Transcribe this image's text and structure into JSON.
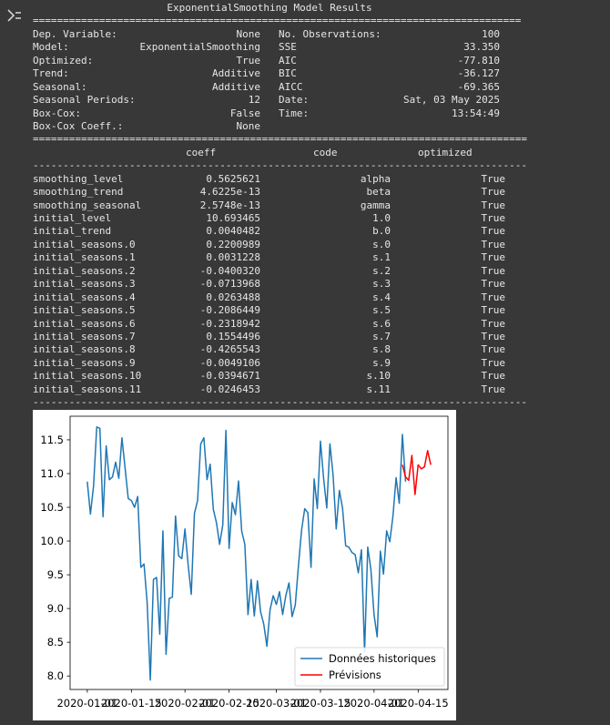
{
  "summary": {
    "title": "ExponentialSmoothing Model Results",
    "separator_eq": "=================================================================================",
    "separator_eq2": "==================================================================================",
    "separator_dash": "----------------------------------------------------------------------------------",
    "info_rows": [
      {
        "k1": "Dep. Variable:",
        "v1": "None",
        "k2": "No. Observations:",
        "v2": "100"
      },
      {
        "k1": "Model:",
        "v1": "ExponentialSmoothing",
        "k2": "SSE",
        "v2": "33.350"
      },
      {
        "k1": "Optimized:",
        "v1": "True",
        "k2": "AIC",
        "v2": "-77.810"
      },
      {
        "k1": "Trend:",
        "v1": "Additive",
        "k2": "BIC",
        "v2": "-36.127"
      },
      {
        "k1": "Seasonal:",
        "v1": "Additive",
        "k2": "AICC",
        "v2": "-69.365"
      },
      {
        "k1": "Seasonal Periods:",
        "v1": "12",
        "k2": "Date:",
        "v2": "Sat, 03 May 2025"
      },
      {
        "k1": "Box-Cox:",
        "v1": "False",
        "k2": "Time:",
        "v2": "13:54:49"
      },
      {
        "k1": "Box-Cox Coeff.:",
        "v1": "None",
        "k2": "",
        "v2": ""
      }
    ],
    "param_headers": {
      "coeff": "coeff",
      "code": "code",
      "optimized": "optimized"
    },
    "params": [
      {
        "name": "smoothing_level",
        "coeff": "0.5625621",
        "code": "alpha",
        "optimized": "True"
      },
      {
        "name": "smoothing_trend",
        "coeff": "4.6225e-13",
        "code": "beta",
        "optimized": "True"
      },
      {
        "name": "smoothing_seasonal",
        "coeff": "2.5748e-13",
        "code": "gamma",
        "optimized": "True"
      },
      {
        "name": "initial_level",
        "coeff": "10.693465",
        "code": "1.0",
        "optimized": "True"
      },
      {
        "name": "initial_trend",
        "coeff": "0.0040482",
        "code": "b.0",
        "optimized": "True"
      },
      {
        "name": "initial_seasons.0",
        "coeff": "0.2200989",
        "code": "s.0",
        "optimized": "True"
      },
      {
        "name": "initial_seasons.1",
        "coeff": "0.0031228",
        "code": "s.1",
        "optimized": "True"
      },
      {
        "name": "initial_seasons.2",
        "coeff": "-0.0400320",
        "code": "s.2",
        "optimized": "True"
      },
      {
        "name": "initial_seasons.3",
        "coeff": "-0.0713968",
        "code": "s.3",
        "optimized": "True"
      },
      {
        "name": "initial_seasons.4",
        "coeff": "0.0263488",
        "code": "s.4",
        "optimized": "True"
      },
      {
        "name": "initial_seasons.5",
        "coeff": "-0.2086449",
        "code": "s.5",
        "optimized": "True"
      },
      {
        "name": "initial_seasons.6",
        "coeff": "-0.2318942",
        "code": "s.6",
        "optimized": "True"
      },
      {
        "name": "initial_seasons.7",
        "coeff": "0.1554496",
        "code": "s.7",
        "optimized": "True"
      },
      {
        "name": "initial_seasons.8",
        "coeff": "-0.4265543",
        "code": "s.8",
        "optimized": "True"
      },
      {
        "name": "initial_seasons.9",
        "coeff": "-0.0049106",
        "code": "s.9",
        "optimized": "True"
      },
      {
        "name": "initial_seasons.10",
        "coeff": "-0.0394671",
        "code": "s.10",
        "optimized": "True"
      },
      {
        "name": "initial_seasons.11",
        "coeff": "-0.0246453",
        "code": "s.11",
        "optimized": "True"
      }
    ]
  },
  "chart_data": {
    "type": "line",
    "ylim": [
      7.8,
      11.85
    ],
    "yticks": [
      8.0,
      8.5,
      9.0,
      9.5,
      10.0,
      10.5,
      11.0,
      11.5
    ],
    "ytick_labels": [
      "8.0",
      "8.5",
      "9.0",
      "9.5",
      "10.0",
      "10.5",
      "11.0",
      "11.5"
    ],
    "xticks": [
      "2020-01-01",
      "2020-01-15",
      "2020-02-01",
      "2020-02-15",
      "2020-03-01",
      "2020-03-15",
      "2020-04-01",
      "2020-04-15"
    ],
    "legend_position": "lower-right",
    "grid": false,
    "series": [
      {
        "name": "Données historiques",
        "color": "#1f77b4",
        "start_date": "2020-01-01",
        "values": [
          10.88,
          10.4,
          10.82,
          11.69,
          11.67,
          10.36,
          11.41,
          10.91,
          10.95,
          11.17,
          10.93,
          11.53,
          11.08,
          10.63,
          10.6,
          10.5,
          10.66,
          9.61,
          9.66,
          9.09,
          7.94,
          9.43,
          9.46,
          8.62,
          10.15,
          8.32,
          9.15,
          9.17,
          10.37,
          9.78,
          9.74,
          10.18,
          9.65,
          9.21,
          10.41,
          10.6,
          11.44,
          11.53,
          10.91,
          11.14,
          10.47,
          10.27,
          9.95,
          10.24,
          11.64,
          9.89,
          10.57,
          10.39,
          10.89,
          10.15,
          9.95,
          8.91,
          9.43,
          8.89,
          9.41,
          8.95,
          8.77,
          8.44,
          8.98,
          9.19,
          9.06,
          9.25,
          8.91,
          9.19,
          9.38,
          8.88,
          9.05,
          9.63,
          10.16,
          10.48,
          10.42,
          9.61,
          10.92,
          10.48,
          11.48,
          10.93,
          10.49,
          11.44,
          10.98,
          10.18,
          10.75,
          10.49,
          9.93,
          9.91,
          9.83,
          9.8,
          9.53,
          9.87,
          8.35,
          9.91,
          9.58,
          8.91,
          8.58,
          9.85,
          9.51,
          10.15,
          9.99,
          10.37,
          10.94,
          10.56,
          11.58,
          10.88
        ]
      },
      {
        "name": "Prévisions",
        "color": "#ff0000",
        "start_date": "2020-04-10",
        "values": [
          11.13,
          10.95,
          10.9,
          11.27,
          10.69,
          11.13,
          11.07,
          11.1,
          11.34,
          11.13
        ]
      }
    ]
  }
}
